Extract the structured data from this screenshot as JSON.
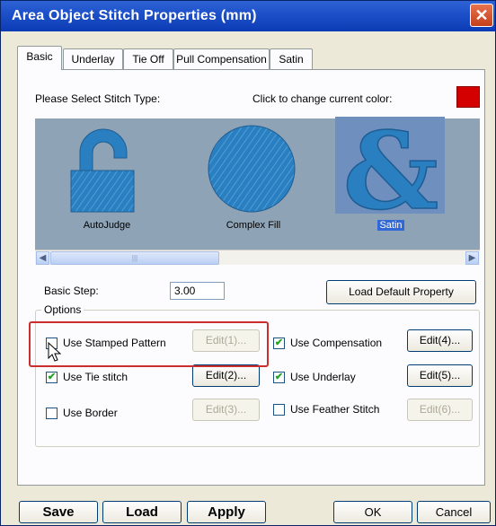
{
  "window": {
    "title": "Area Object Stitch Properties   (mm)"
  },
  "tabs": [
    "Basic",
    "Underlay",
    "Tie Off",
    "Pull Compensation",
    "Satin"
  ],
  "basic": {
    "stitch_type_label": "Please Select Stitch Type:",
    "color_label": "Click to change current color:",
    "current_color": "#d40000",
    "stitch_types": [
      {
        "label": "AutoJudge",
        "icon": "padlock-icon",
        "selected": false
      },
      {
        "label": "Complex Fill",
        "icon": "circle-icon",
        "selected": false
      },
      {
        "label": "Satin",
        "icon": "ampersand-icon",
        "selected": true
      }
    ],
    "step_label": "Basic Step:",
    "step_value": "3.00",
    "load_default_label": "Load Default Property",
    "options_label": "Options",
    "options": [
      {
        "label": "Use Stamped Pattern",
        "checked": false,
        "edit": "Edit(1)...",
        "edit_enabled": false
      },
      {
        "label": "Use Tie stitch",
        "checked": true,
        "edit": "Edit(2)...",
        "edit_enabled": true
      },
      {
        "label": "Use Border",
        "checked": false,
        "edit": "Edit(3)...",
        "edit_enabled": false
      },
      {
        "label": "Use Compensation",
        "checked": true,
        "edit": "Edit(4)...",
        "edit_enabled": true
      },
      {
        "label": "Use Underlay",
        "checked": true,
        "edit": "Edit(5)...",
        "edit_enabled": true
      },
      {
        "label": "Use Feather Stitch",
        "checked": false,
        "edit": "Edit(6)...",
        "edit_enabled": false
      }
    ]
  },
  "footer": {
    "save": "Save",
    "load": "Load",
    "apply": "Apply",
    "ok": "OK",
    "cancel": "Cancel"
  },
  "icons": {
    "close": "close-icon",
    "scroll_left": "chevron-left-icon",
    "scroll_right": "chevron-right-icon",
    "check": "checkmark-icon",
    "cursor": "mouse-pointer-icon"
  }
}
